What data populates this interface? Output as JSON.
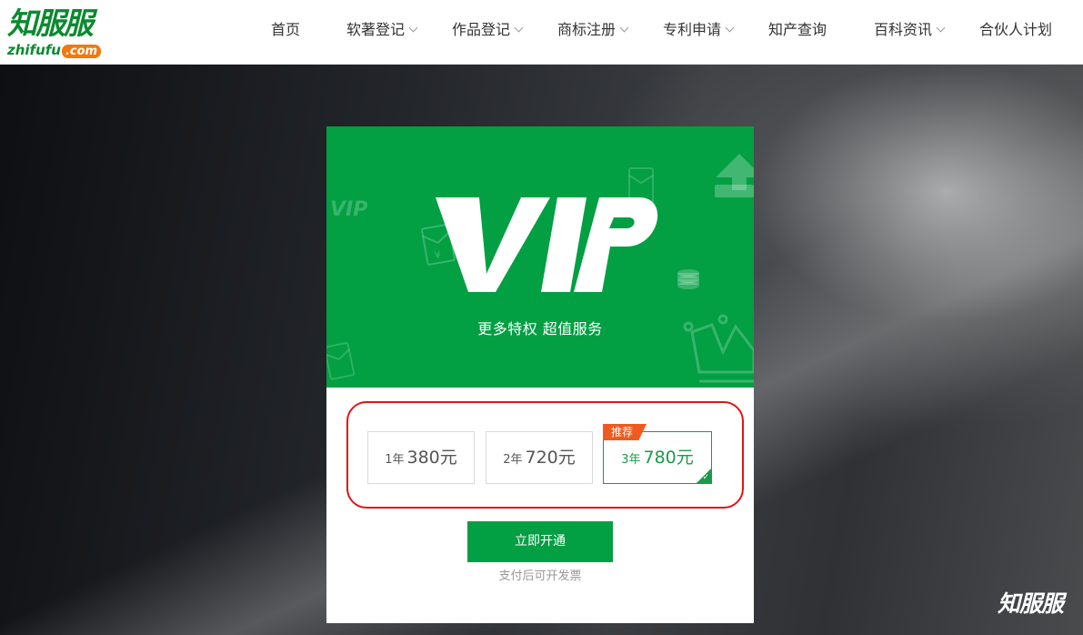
{
  "brand": {
    "logo_cn": "知服服",
    "logo_en_main": "zhifufu",
    "logo_en_suffix": ".com",
    "footer_logo": "知服服",
    "green": "#029f43",
    "orange": "#ee7a10"
  },
  "nav": {
    "items": [
      {
        "label": "首页",
        "has_dropdown": false
      },
      {
        "label": "软著登记",
        "has_dropdown": true
      },
      {
        "label": "作品登记",
        "has_dropdown": true
      },
      {
        "label": "商标注册",
        "has_dropdown": true
      },
      {
        "label": "专利申请",
        "has_dropdown": true
      },
      {
        "label": "知产查询",
        "has_dropdown": false
      },
      {
        "label": "百科资讯",
        "has_dropdown": true
      },
      {
        "label": "合伙人计划",
        "has_dropdown": false
      }
    ]
  },
  "vip": {
    "title": "VIP",
    "subtitle": "更多特权 超值服务",
    "plans": [
      {
        "years_label": "1年",
        "price": "380元",
        "selected": false
      },
      {
        "years_label": "2年",
        "price": "720元",
        "selected": false
      },
      {
        "years_label": "3年",
        "price": "780元",
        "selected": true,
        "badge": "推荐"
      }
    ],
    "cta_label": "立即开通",
    "note": "支付后可开发票",
    "highlight_color": "#e01515"
  },
  "icons": [
    "chevron-down-icon",
    "envelope-icon",
    "upload-tray-icon",
    "coin-stack-icon",
    "crown-icon",
    "checkmark-icon"
  ]
}
